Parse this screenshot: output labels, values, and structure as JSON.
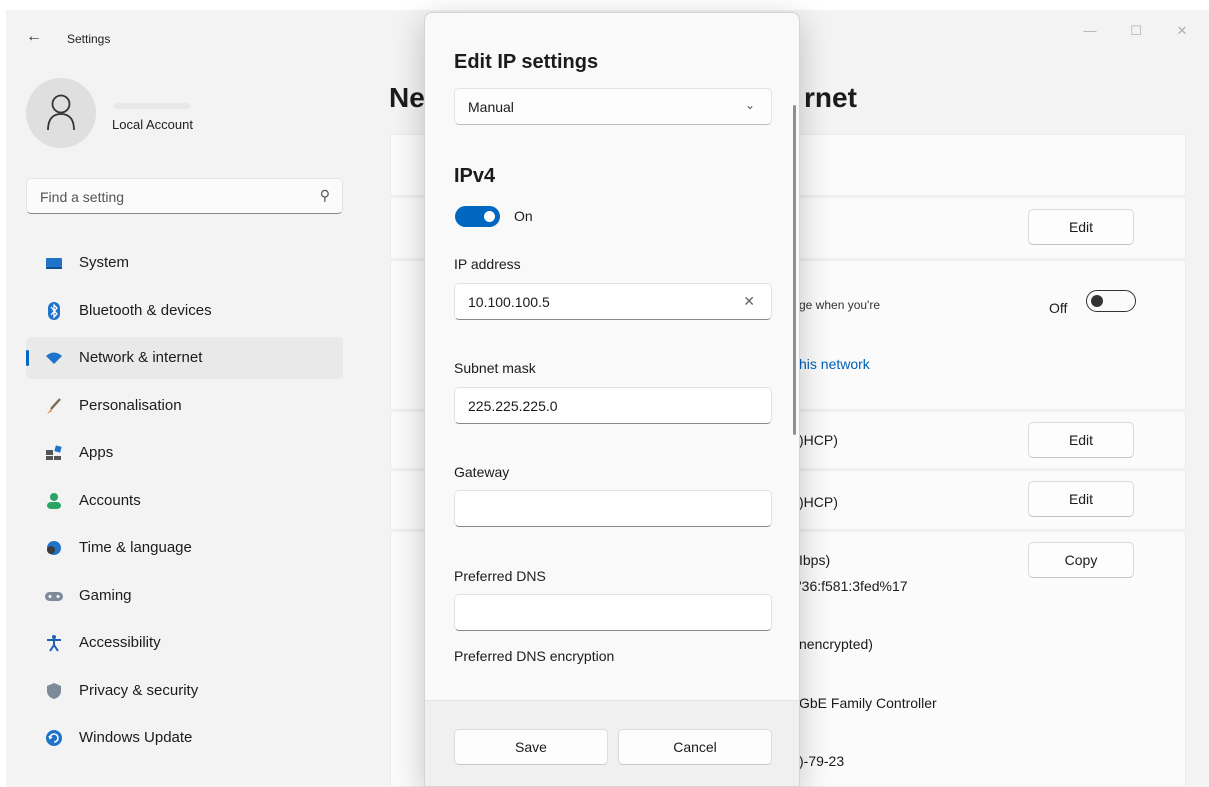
{
  "window": {
    "title": "Settings",
    "controls": {
      "minimize": "—",
      "maximize": "☐",
      "close": "✕"
    }
  },
  "profile": {
    "account_type": "Local Account"
  },
  "search": {
    "placeholder": "Find a setting"
  },
  "sidebar": {
    "items": [
      {
        "label": "System",
        "icon": "system-icon",
        "active": false
      },
      {
        "label": "Bluetooth & devices",
        "icon": "bluetooth-icon",
        "active": false
      },
      {
        "label": "Network & internet",
        "icon": "wifi-icon",
        "active": true
      },
      {
        "label": "Personalisation",
        "icon": "brush-icon",
        "active": false
      },
      {
        "label": "Apps",
        "icon": "apps-icon",
        "active": false
      },
      {
        "label": "Accounts",
        "icon": "person-icon",
        "active": false
      },
      {
        "label": "Time & language",
        "icon": "globe-clock-icon",
        "active": false
      },
      {
        "label": "Gaming",
        "icon": "gamepad-icon",
        "active": false
      },
      {
        "label": "Accessibility",
        "icon": "accessibility-icon",
        "active": false
      },
      {
        "label": "Privacy & security",
        "icon": "shield-icon",
        "active": false
      },
      {
        "label": "Windows Update",
        "icon": "update-icon",
        "active": false
      }
    ]
  },
  "main": {
    "title_left": "Ne",
    "title_right": "rnet",
    "metered_text": "ge when you're",
    "metered_state": "Off",
    "data_limit_link": "his network",
    "ip_assignment": ")HCP)",
    "dns_assignment": ")HCP)",
    "link_speed": "Ibps)",
    "ipv6_address": "'36:f581:3fed%17",
    "dns_encryption": "nencrypted)",
    "adapter": "GbE Family Controller",
    "mac": ")-79-23",
    "edit_label": "Edit",
    "copy_label": "Copy"
  },
  "dialog": {
    "title": "Edit IP settings",
    "mode": "Manual",
    "section": "IPv4",
    "ipv4_enabled": true,
    "ipv4_toggle_label": "On",
    "fields": {
      "ip_address_label": "IP address",
      "ip_address": "10.100.100.5",
      "subnet_label": "Subnet mask",
      "subnet": "225.225.225.0",
      "gateway_label": "Gateway",
      "gateway": "",
      "preferred_dns_label": "Preferred DNS",
      "preferred_dns": "",
      "dns_encryption_label": "Preferred DNS encryption"
    },
    "save_label": "Save",
    "cancel_label": "Cancel"
  },
  "colors": {
    "accent": "#0067c0",
    "link": "#0060b8",
    "window_bg": "#f3f3f3",
    "card_bg": "#fbfbfb"
  }
}
